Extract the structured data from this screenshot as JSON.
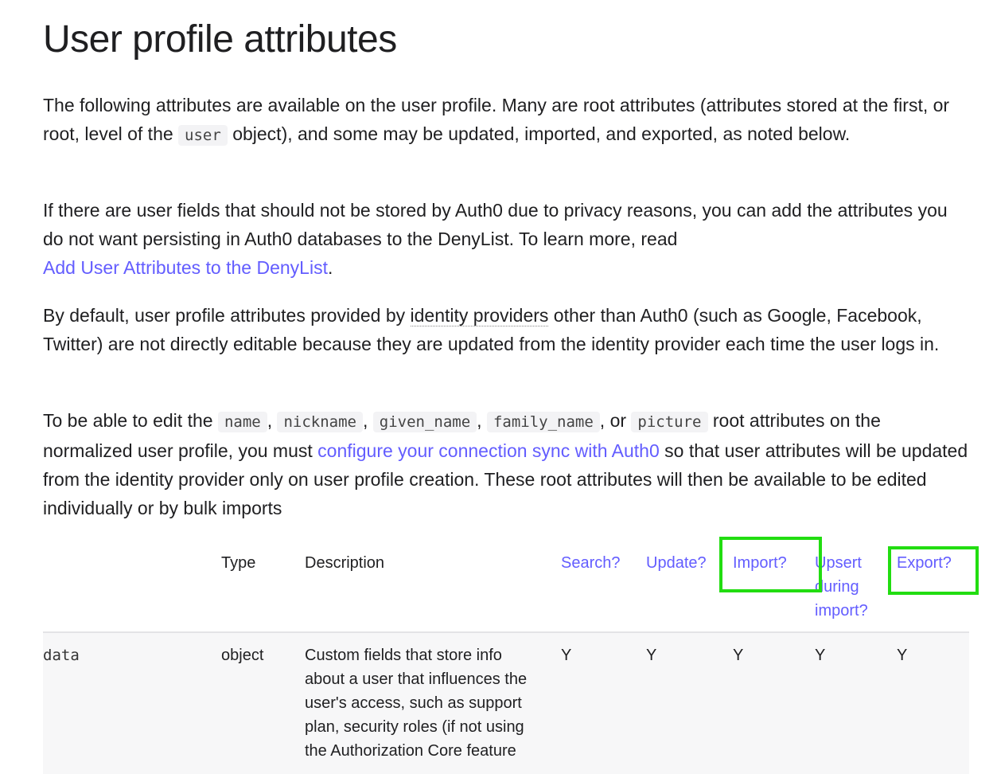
{
  "title": "User profile attributes",
  "para1": {
    "t1": "The following attributes are available on the user profile. Many are root attributes (attributes stored at the first, or root, level of the ",
    "code": "user",
    "t2": " object), and some may be updated, imported, and exported, as noted below."
  },
  "para2": {
    "t1": "If there are user fields that should not be stored by Auth0 due to privacy reasons, you can add the attributes you do not want persisting in Auth0 databases to the DenyList. To learn more, read ",
    "link": "Add User Attributes to the DenyList",
    "t2": "."
  },
  "para3": {
    "t1": "By default, user profile attributes provided by ",
    "term": "identity providers",
    "t2": " other than Auth0 (such as Google, Facebook, Twitter) are not directly editable because they are updated from the identity provider each time the user logs in."
  },
  "para4": {
    "t1": "To be able to edit the ",
    "c1": "name",
    "s1": ", ",
    "c2": "nickname",
    "s2": ", ",
    "c3": "given_name",
    "s3": ", ",
    "c4": "family_name",
    "s4": ", or ",
    "c5": "picture",
    "t2": " root attributes on the normalized user profile, you must ",
    "link": "configure your connection sync with Auth0",
    "t3": " so that user attributes will be updated from the identity provider only on user profile creation. These root attributes will then be available to be edited individually or by bulk imports"
  },
  "table": {
    "headers": {
      "type": "Type",
      "description": "Description",
      "search": "Search?",
      "update": "Update?",
      "import": "Import?",
      "upsert": "Upsert during import?",
      "export": "Export?"
    },
    "rows": [
      {
        "name": "data",
        "type": "object",
        "description": "Custom fields that store info about a user that influences the user's access, such as support plan, security roles (if not using the Authorization Core feature",
        "search": "Y",
        "update": "Y",
        "import": "Y",
        "upsert": "Y",
        "export": "Y"
      }
    ]
  },
  "colors": {
    "link": "#635dff",
    "highlight": "#22dd11",
    "row_background": "#f7f7f8"
  }
}
